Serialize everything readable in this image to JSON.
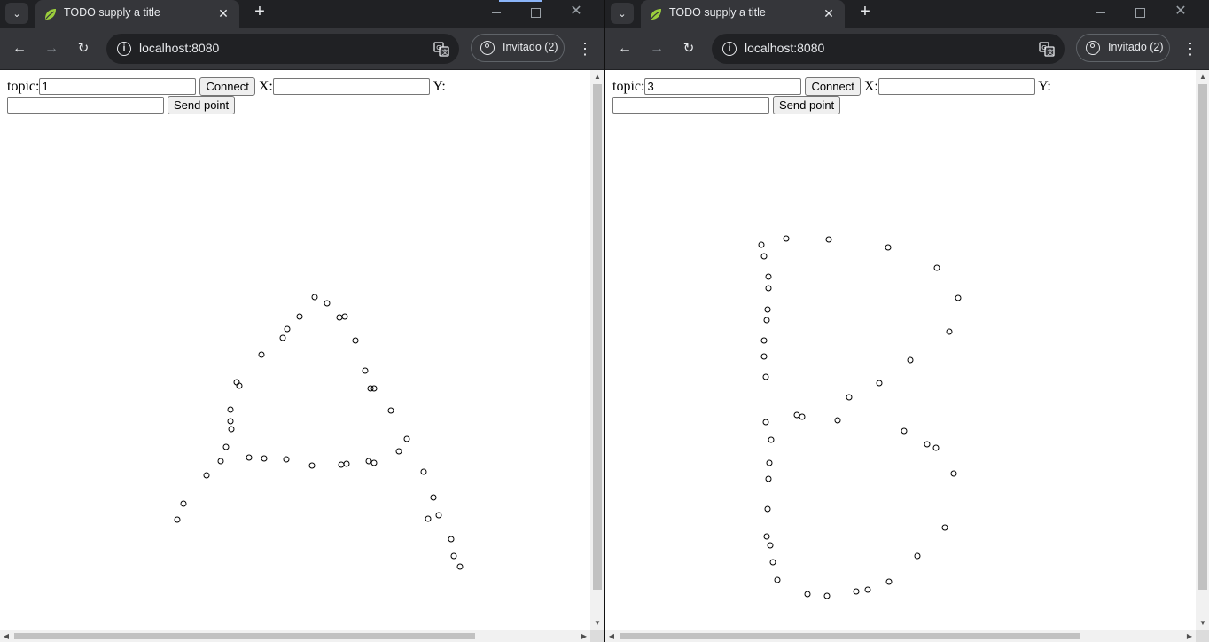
{
  "windows": [
    {
      "tab": {
        "title": "TODO supply a title",
        "favicon": "spring-leaf-icon"
      },
      "address": {
        "url": "localhost:8080"
      },
      "profile": {
        "label": "Invitado (2)"
      },
      "form": {
        "topic_label": "topic:",
        "topic_value": "1",
        "connect_label": "Connect",
        "x_label": "X:",
        "x_value": "",
        "y_label": "Y:",
        "y_value": "",
        "send_label": "Send point"
      },
      "points_shape": "A",
      "points": [
        [
          355,
          196
        ],
        [
          369,
          203
        ],
        [
          383,
          219
        ],
        [
          389,
          218
        ],
        [
          338,
          218
        ],
        [
          324,
          232
        ],
        [
          319,
          242
        ],
        [
          401,
          245
        ],
        [
          295,
          261
        ],
        [
          412,
          279
        ],
        [
          267,
          292
        ],
        [
          270,
          296
        ],
        [
          418,
          299
        ],
        [
          422,
          299
        ],
        [
          260,
          323
        ],
        [
          441,
          324
        ],
        [
          260,
          336
        ],
        [
          261,
          345
        ],
        [
          459,
          356
        ],
        [
          255,
          365
        ],
        [
          450,
          370
        ],
        [
          249,
          381
        ],
        [
          281,
          377
        ],
        [
          298,
          378
        ],
        [
          323,
          379
        ],
        [
          352,
          386
        ],
        [
          385,
          385
        ],
        [
          391,
          384
        ],
        [
          416,
          381
        ],
        [
          422,
          383
        ],
        [
          233,
          397
        ],
        [
          478,
          393
        ],
        [
          207,
          429
        ],
        [
          489,
          422
        ],
        [
          200,
          447
        ],
        [
          483,
          446
        ],
        [
          495,
          442
        ],
        [
          509,
          469
        ],
        [
          512,
          488
        ],
        [
          519,
          500
        ]
      ]
    },
    {
      "tab": {
        "title": "TODO supply a title",
        "favicon": "spring-leaf-icon"
      },
      "address": {
        "url": "localhost:8080"
      },
      "profile": {
        "label": "Invitado (2)"
      },
      "form": {
        "topic_label": "topic:",
        "topic_value": "3",
        "connect_label": "Connect",
        "x_label": "X:",
        "x_value": "",
        "y_label": "Y:",
        "y_value": "",
        "send_label": "Send point"
      },
      "points_shape": "B",
      "points": [
        [
          176,
          137
        ],
        [
          204,
          130
        ],
        [
          252,
          131
        ],
        [
          319,
          140
        ],
        [
          179,
          150
        ],
        [
          374,
          163
        ],
        [
          184,
          173
        ],
        [
          398,
          197
        ],
        [
          184,
          186
        ],
        [
          183,
          210
        ],
        [
          388,
          235
        ],
        [
          182,
          222
        ],
        [
          179,
          245
        ],
        [
          344,
          267
        ],
        [
          179,
          263
        ],
        [
          181,
          286
        ],
        [
          309,
          293
        ],
        [
          275,
          309
        ],
        [
          216,
          329
        ],
        [
          222,
          331
        ],
        [
          262,
          335
        ],
        [
          181,
          337
        ],
        [
          187,
          357
        ],
        [
          337,
          347
        ],
        [
          363,
          362
        ],
        [
          373,
          366
        ],
        [
          185,
          383
        ],
        [
          393,
          395
        ],
        [
          184,
          401
        ],
        [
          383,
          456
        ],
        [
          183,
          435
        ],
        [
          182,
          466
        ],
        [
          186,
          476
        ],
        [
          352,
          488
        ],
        [
          189,
          495
        ],
        [
          194,
          515
        ],
        [
          320,
          517
        ],
        [
          228,
          531
        ],
        [
          250,
          533
        ],
        [
          283,
          528
        ],
        [
          296,
          526
        ]
      ]
    }
  ],
  "colors": {
    "chrome_dark": "#202124",
    "chrome_toolbar": "#35363a",
    "text_light": "#e8eaed",
    "page_bg": "#ffffff"
  }
}
